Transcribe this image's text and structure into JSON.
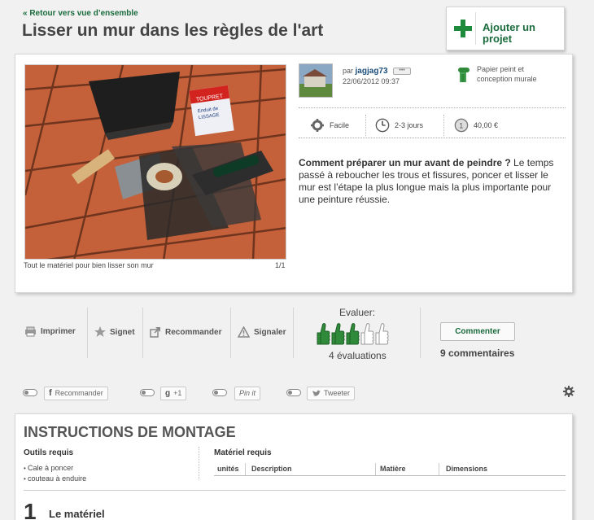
{
  "header": {
    "back_link": "« Retour vers vue d’ensemble",
    "title": "Lisser un mur dans les règles de l'art",
    "add_project_line1": "Ajouter un",
    "add_project_line2": "projet"
  },
  "gallery": {
    "caption": "Tout le matériel pour bien lisser son mur",
    "counter": "1/1",
    "product_brand": "TOUPRET",
    "product_line1": "Enduit de",
    "product_line2": "LISSAGE"
  },
  "author": {
    "prefix": "par",
    "name": "jagjag73",
    "date": "22/06/2012 09:37",
    "more_label": "•••"
  },
  "category": {
    "line1": "Papier peint et",
    "line2": "conception murale",
    "icon": "wallpaper-roll-icon"
  },
  "stats": {
    "difficulty": "Facile",
    "duration": "2-3 jours",
    "cost": "40,00 €"
  },
  "summary": {
    "lead": "Comment préparer un mur avant de peindre ?",
    "body": " Le temps passé à reboucher les trous et fissures, poncer et lisser le mur est l’étape la plus longue mais la plus importante pour une peinture réussie."
  },
  "actions": {
    "print": "Imprimer",
    "bookmark": "Signet",
    "recommend": "Recommander",
    "report": "Signaler"
  },
  "rating": {
    "label": "Evaluer:",
    "filled": 3,
    "total": 5,
    "count_text": "4 évaluations"
  },
  "comments": {
    "button": "Commenter",
    "count_text": "9 commentaires"
  },
  "social": {
    "facebook": "Recommander",
    "gplus": "+1",
    "pinterest": "Pin it",
    "twitter": "Tweeter"
  },
  "instructions": {
    "title": "INSTRUCTIONS DE MONTAGE",
    "tools_heading": "Outils requis",
    "tools": [
      "Cale à poncer",
      "couteau à enduire"
    ],
    "materials_heading": "Matériel requis",
    "columns": [
      "unités",
      "Description",
      "Matière",
      "Dimensions"
    ],
    "step_number": "1",
    "step_title": "Le matériel"
  },
  "colors": {
    "accent_green": "#1a6b3c",
    "plus_green": "#1e8a3c",
    "thumb_green": "#2f8a3a"
  }
}
